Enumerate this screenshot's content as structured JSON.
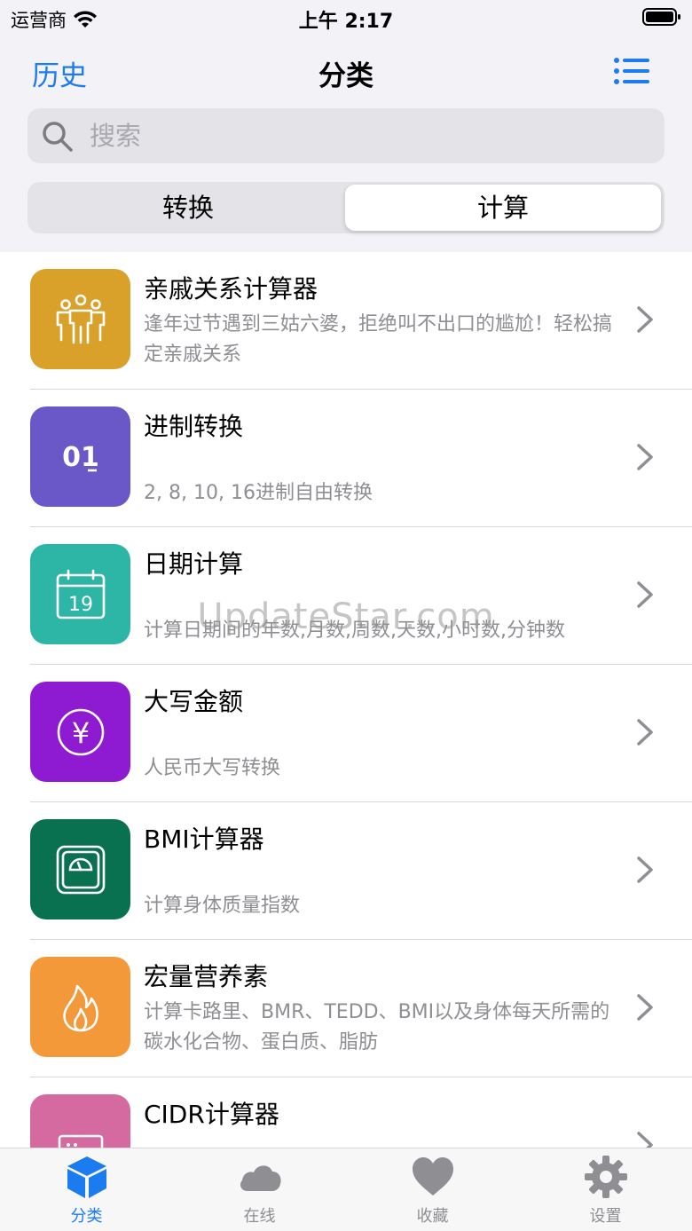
{
  "status_bar": {
    "carrier": "运营商",
    "time": "上午 2:17"
  },
  "nav": {
    "history_label": "历史",
    "title": "分类"
  },
  "search": {
    "placeholder": "搜索"
  },
  "segments": {
    "left_label": "转换",
    "right_label": "计算",
    "selected": "计算"
  },
  "list": {
    "items": [
      {
        "title": "亲戚关系计算器",
        "description": "逢年过节遇到三姑六婆，拒绝叫不出口的尴尬！轻松搞定亲戚关系",
        "icon": "family-icon",
        "color": "#d9a12a"
      },
      {
        "title": "进制转换",
        "description": "2, 8, 10, 16进制自由转换",
        "icon": "binary-icon",
        "icon_text": "01",
        "color": "#6a58c9"
      },
      {
        "title": "日期计算",
        "description": "计算日期间的年数,月数,周数,天数,小时数,分钟数",
        "icon": "calendar-icon",
        "icon_text": "19",
        "color": "#2db5a6"
      },
      {
        "title": "大写金额",
        "description": "人民币大写转换",
        "icon": "yen-icon",
        "icon_text": "¥",
        "color": "#8e1bd1"
      },
      {
        "title": "BMI计算器",
        "description": "计算身体质量指数",
        "icon": "scale-icon",
        "color": "#0a7150"
      },
      {
        "title": "宏量营养素",
        "description": "计算卡路里、BMR、TEDD、BMI以及身体每天所需的碳水化合物、蛋白质、脂肪",
        "icon": "flame-icon",
        "color": "#f4993a"
      },
      {
        "title": "CIDR计算器",
        "description": "",
        "icon": "network-icon",
        "color": "#d46aa0"
      }
    ]
  },
  "watermark": "UpdateStar.com",
  "tab_bar": {
    "tabs": [
      {
        "label": "分类",
        "icon": "cube-icon",
        "active": true
      },
      {
        "label": "在线",
        "icon": "cloud-icon",
        "active": false
      },
      {
        "label": "收藏",
        "icon": "heart-icon",
        "active": false
      },
      {
        "label": "设置",
        "icon": "gear-icon",
        "active": false
      }
    ]
  },
  "colors": {
    "accent": "#1b7bf0",
    "secondary_text": "#8e8e93",
    "background": "#f2f2f7"
  }
}
